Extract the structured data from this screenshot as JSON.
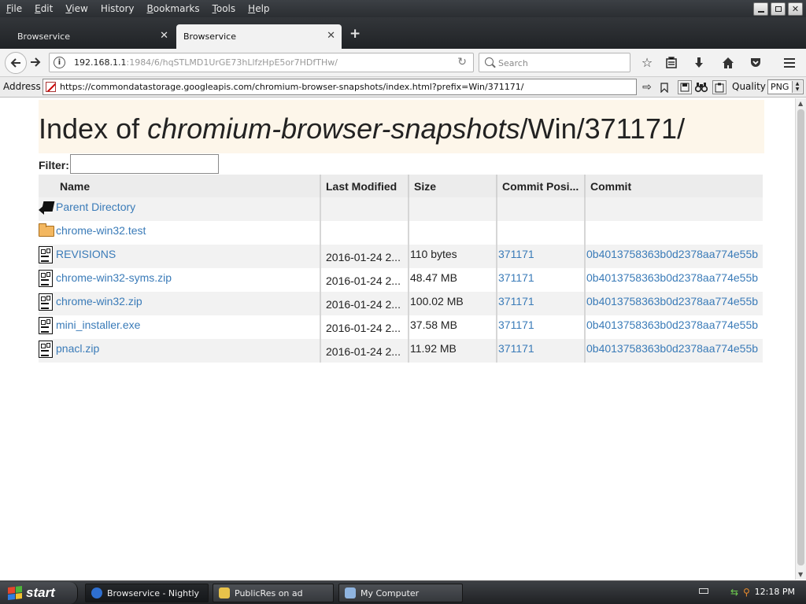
{
  "menubar": {
    "items": [
      {
        "acc": "F",
        "rest": "ile"
      },
      {
        "acc": "E",
        "rest": "dit"
      },
      {
        "acc": "V",
        "rest": "iew"
      },
      {
        "acc": "",
        "rest": "History",
        "acc_after": "S"
      },
      {
        "acc": "B",
        "rest": "ookmarks"
      },
      {
        "acc": "T",
        "rest": "ools"
      },
      {
        "acc": "H",
        "rest": "elp"
      }
    ]
  },
  "tabs": {
    "inactive_label": "Browservice",
    "active_label": "Browservice",
    "close_glyph": "✕",
    "new_tab_glyph": "+"
  },
  "navbar": {
    "url_host": "192.168.1.1",
    "url_path": ":1984/6/hqSTLMD1UrGE73hLlfzHpE5or7HDfTHw/",
    "search_placeholder": "Search"
  },
  "addressbar": {
    "label": "Address",
    "url": "https://commondatastorage.googleapis.com/chromium-browser-snapshots/index.html?prefix=Win/371171/",
    "quality_label": "Quality",
    "quality_value": "PNG"
  },
  "page": {
    "title_prefix": "Index of ",
    "title_italic": "chromium-browser-snapshots",
    "title_suffix": "/Win/371171/",
    "filter_label": "Filter:",
    "columns": [
      "Name",
      "Last Modified",
      "Size",
      "Commit Posi...",
      "Commit"
    ],
    "rows": [
      {
        "icon": "back",
        "name": "Parent Directory",
        "modified": "",
        "size": "",
        "commit_pos": "",
        "commit": ""
      },
      {
        "icon": "folder",
        "name": "chrome-win32.test",
        "modified": "",
        "size": "",
        "commit_pos": "",
        "commit": ""
      },
      {
        "icon": "file",
        "name": "REVISIONS",
        "modified": "2016-01-24 2...",
        "size": "110 bytes",
        "commit_pos": "371171",
        "commit": "0b4013758363b0d2378aa774e55b"
      },
      {
        "icon": "file",
        "name": "chrome-win32-syms.zip",
        "modified": "2016-01-24 2...",
        "size": "48.47 MB",
        "commit_pos": "371171",
        "commit": "0b4013758363b0d2378aa774e55b"
      },
      {
        "icon": "file",
        "name": "chrome-win32.zip",
        "modified": "2016-01-24 2...",
        "size": "100.02 MB",
        "commit_pos": "371171",
        "commit": "0b4013758363b0d2378aa774e55b"
      },
      {
        "icon": "file",
        "name": "mini_installer.exe",
        "modified": "2016-01-24 2...",
        "size": "37.58 MB",
        "commit_pos": "371171",
        "commit": "0b4013758363b0d2378aa774e55b"
      },
      {
        "icon": "file",
        "name": "pnacl.zip",
        "modified": "2016-01-24 2...",
        "size": "11.92 MB",
        "commit_pos": "371171",
        "commit": "0b4013758363b0d2378aa774e55b"
      }
    ]
  },
  "taskbar": {
    "start_label": "start",
    "items": [
      {
        "label": "Browservice - Nightly",
        "icon_color": "#2e6fd0"
      },
      {
        "label": "PublicRes on ad",
        "icon_color": "#e8c24a"
      },
      {
        "label": "My Computer",
        "icon_color": "#8fb4e0"
      }
    ],
    "clock": "12:18 PM"
  },
  "colors": {
    "link": "#3a7bb8",
    "header_bg": "#fdf6ea"
  }
}
